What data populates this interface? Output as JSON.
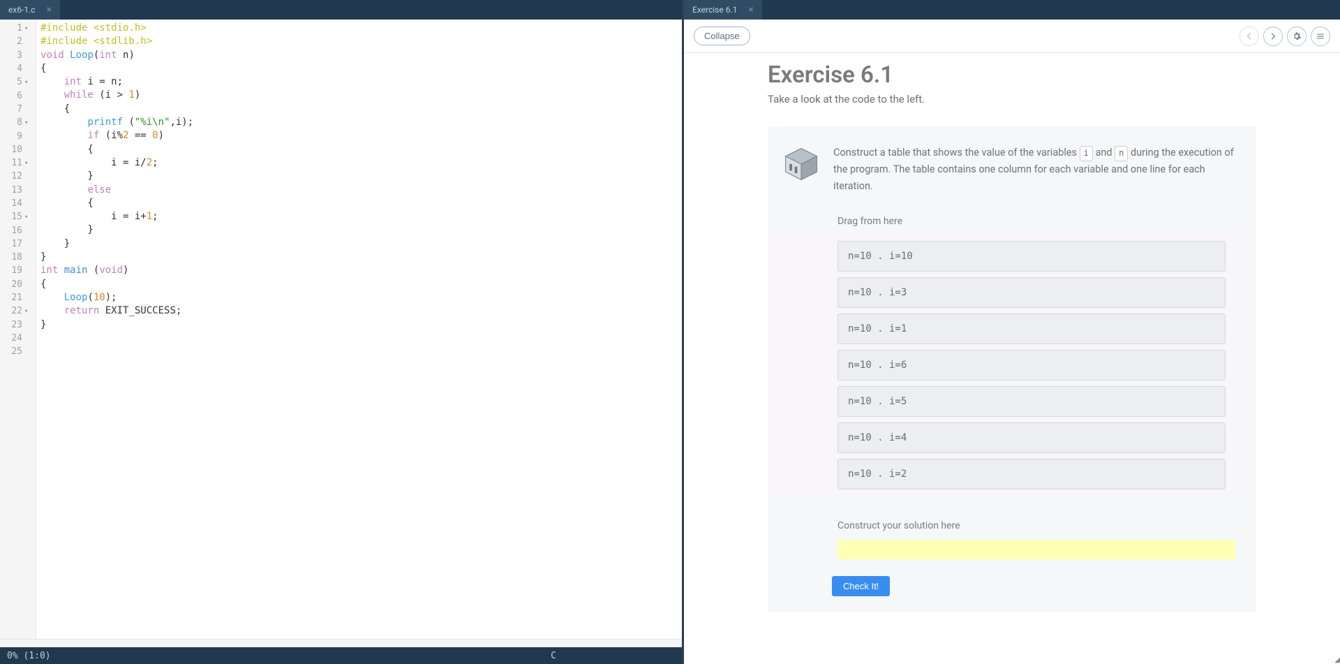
{
  "left": {
    "tab_label": "ex6-1.c",
    "status_left": "0% (1:0)",
    "status_right": "C",
    "gutter": [
      {
        "n": "1",
        "f": "▾"
      },
      {
        "n": "2",
        "f": ""
      },
      {
        "n": "3",
        "f": ""
      },
      {
        "n": "4",
        "f": ""
      },
      {
        "n": "5",
        "f": "▾"
      },
      {
        "n": "6",
        "f": ""
      },
      {
        "n": "7",
        "f": ""
      },
      {
        "n": "8",
        "f": "▾"
      },
      {
        "n": "9",
        "f": ""
      },
      {
        "n": "10",
        "f": ""
      },
      {
        "n": "11",
        "f": "▾"
      },
      {
        "n": "12",
        "f": ""
      },
      {
        "n": "13",
        "f": ""
      },
      {
        "n": "14",
        "f": ""
      },
      {
        "n": "15",
        "f": "▾"
      },
      {
        "n": "16",
        "f": ""
      },
      {
        "n": "17",
        "f": ""
      },
      {
        "n": "18",
        "f": ""
      },
      {
        "n": "19",
        "f": ""
      },
      {
        "n": "20",
        "f": ""
      },
      {
        "n": "21",
        "f": ""
      },
      {
        "n": "22",
        "f": "▾"
      },
      {
        "n": "23",
        "f": ""
      },
      {
        "n": "24",
        "f": ""
      },
      {
        "n": "25",
        "f": ""
      }
    ],
    "code_tokens": [
      [
        [
          "preproc",
          "#include <stdio.h>"
        ]
      ],
      [
        [
          "preproc",
          "#include <stdlib.h>"
        ]
      ],
      [
        [
          "",
          ""
        ]
      ],
      [
        [
          "type",
          "void"
        ],
        [
          "",
          " "
        ],
        [
          "func",
          "Loop"
        ],
        [
          "",
          "("
        ],
        [
          "type",
          "int"
        ],
        [
          "",
          " n)"
        ]
      ],
      [
        [
          "",
          "{"
        ]
      ],
      [
        [
          "",
          "    "
        ],
        [
          "type",
          "int"
        ],
        [
          "",
          " i = n;"
        ]
      ],
      [
        [
          "",
          "    "
        ],
        [
          "keyword",
          "while"
        ],
        [
          "",
          " (i > "
        ],
        [
          "number",
          "1"
        ],
        [
          "",
          ")"
        ]
      ],
      [
        [
          "",
          "    {"
        ]
      ],
      [
        [
          "",
          "        "
        ],
        [
          "func",
          "printf"
        ],
        [
          "",
          " ("
        ],
        [
          "string",
          "\"%i\\n\""
        ],
        [
          "",
          ",i);"
        ]
      ],
      [
        [
          "",
          "        "
        ],
        [
          "keyword",
          "if"
        ],
        [
          "",
          " (i%"
        ],
        [
          "number",
          "2"
        ],
        [
          "",
          " == "
        ],
        [
          "number",
          "0"
        ],
        [
          "",
          ")"
        ]
      ],
      [
        [
          "",
          "        {"
        ]
      ],
      [
        [
          "",
          "            i = i/"
        ],
        [
          "number",
          "2"
        ],
        [
          "",
          ";"
        ]
      ],
      [
        [
          "",
          "        }"
        ]
      ],
      [
        [
          "",
          "        "
        ],
        [
          "keyword",
          "else"
        ]
      ],
      [
        [
          "",
          "        {"
        ]
      ],
      [
        [
          "",
          "            i = i+"
        ],
        [
          "number",
          "1"
        ],
        [
          "",
          ";"
        ]
      ],
      [
        [
          "",
          "        }"
        ]
      ],
      [
        [
          "",
          "    }"
        ]
      ],
      [
        [
          "",
          "}"
        ]
      ],
      [
        [
          "",
          ""
        ]
      ],
      [
        [
          "type",
          "int"
        ],
        [
          "",
          " "
        ],
        [
          "ident",
          "main"
        ],
        [
          "",
          " ("
        ],
        [
          "type",
          "void"
        ],
        [
          "",
          ")"
        ]
      ],
      [
        [
          "",
          "{"
        ]
      ],
      [
        [
          "",
          "    "
        ],
        [
          "func",
          "Loop"
        ],
        [
          "",
          "("
        ],
        [
          "number",
          "10"
        ],
        [
          "",
          ");"
        ]
      ],
      [
        [
          "",
          "    "
        ],
        [
          "keyword",
          "return"
        ],
        [
          "",
          " EXIT_SUCCESS;"
        ]
      ],
      [
        [
          "",
          "}"
        ]
      ]
    ]
  },
  "right": {
    "tab_label": "Exercise 6.1",
    "collapse_label": "Collapse",
    "title": "Exercise 6.1",
    "subtitle": "Take a look at the code to the left.",
    "instruction_pre": "Construct a table that shows the value of the variables ",
    "kbd1": "i",
    "mid1": " and ",
    "kbd2": "n",
    "instruction_post": " during the execution of the program. The table contains one column for each variable and one line for each iteration.",
    "drag_label": "Drag from here",
    "options": [
      "n=10 . i=10",
      "n=10 . i=3",
      "n=10 . i=1",
      "n=10 . i=6",
      "n=10 . i=5",
      "n=10 . i=4",
      "n=10 . i=2"
    ],
    "construct_label": "Construct your solution here",
    "check_label": "Check It!"
  }
}
